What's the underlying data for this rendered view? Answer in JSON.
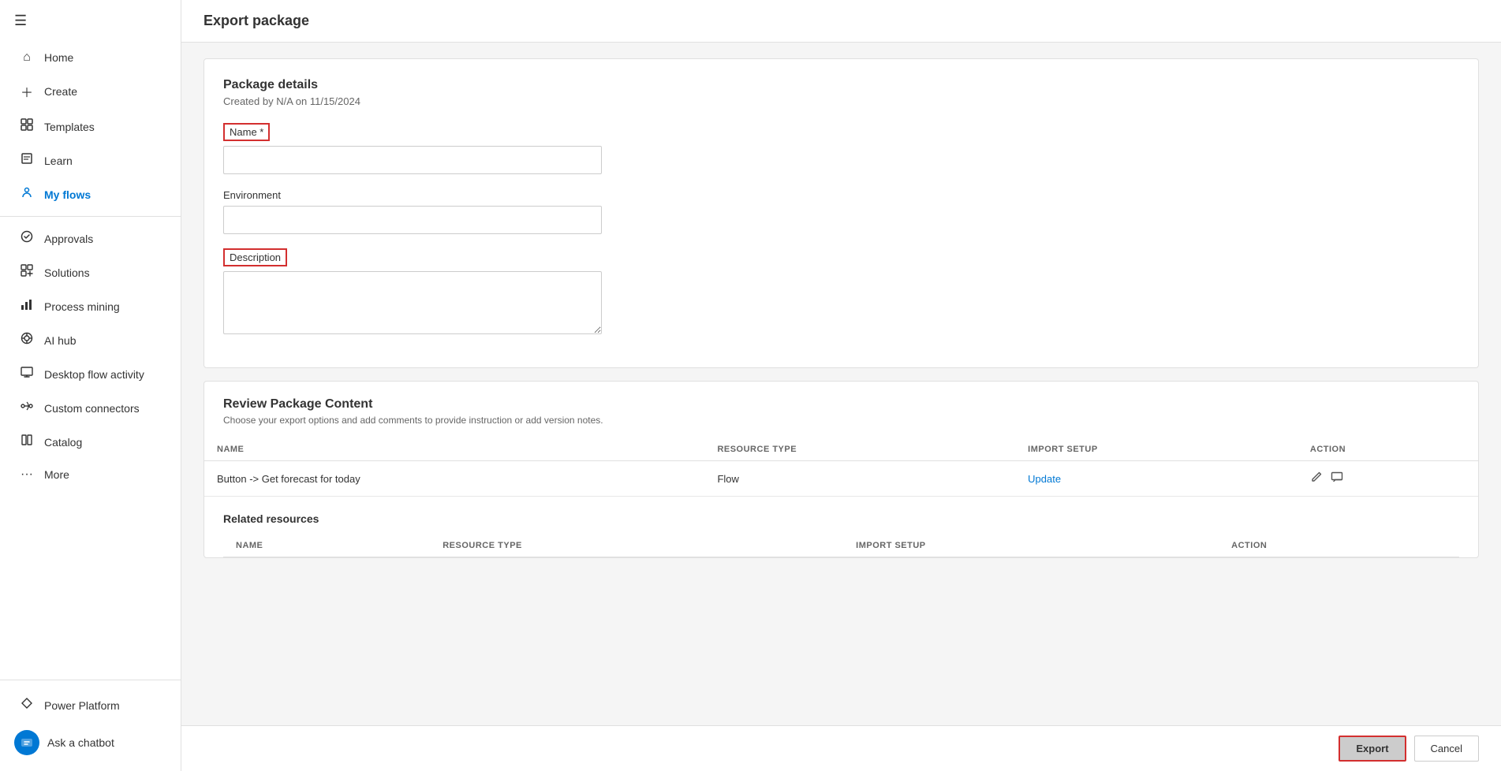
{
  "sidebar": {
    "hamburger_icon": "☰",
    "items": [
      {
        "id": "home",
        "label": "Home",
        "icon": "⌂",
        "active": false
      },
      {
        "id": "create",
        "label": "Create",
        "icon": "+",
        "active": false
      },
      {
        "id": "templates",
        "label": "Templates",
        "icon": "📄",
        "active": false
      },
      {
        "id": "learn",
        "label": "Learn",
        "icon": "📖",
        "active": false
      },
      {
        "id": "my-flows",
        "label": "My flows",
        "icon": "💧",
        "active": true
      },
      {
        "id": "approvals",
        "label": "Approvals",
        "icon": "✅",
        "active": false
      },
      {
        "id": "solutions",
        "label": "Solutions",
        "icon": "🧩",
        "active": false
      },
      {
        "id": "process-mining",
        "label": "Process mining",
        "icon": "📊",
        "active": false
      },
      {
        "id": "ai-hub",
        "label": "AI hub",
        "icon": "🤖",
        "active": false
      },
      {
        "id": "desktop-flow-activity",
        "label": "Desktop flow activity",
        "icon": "🖥",
        "active": false
      },
      {
        "id": "custom-connectors",
        "label": "Custom connectors",
        "icon": "🔗",
        "active": false
      },
      {
        "id": "catalog",
        "label": "Catalog",
        "icon": "📚",
        "active": false
      },
      {
        "id": "more",
        "label": "More",
        "icon": "···",
        "active": false
      }
    ],
    "bottom": {
      "power_platform_label": "Power Platform",
      "chatbot_label": "Ask a chatbot"
    }
  },
  "page": {
    "title": "Export package"
  },
  "package_details": {
    "section_title": "Package details",
    "created_text": "Created by N/A on 11/15/2024",
    "name_label": "Name *",
    "name_placeholder": "",
    "name_value": "",
    "environment_label": "Environment",
    "environment_placeholder": "",
    "environment_value": "",
    "description_label": "Description",
    "description_placeholder": "",
    "description_value": ""
  },
  "review_package": {
    "section_title": "Review Package Content",
    "subtitle": "Choose your export options and add comments to provide instruction or add version notes.",
    "table_headers": {
      "name": "NAME",
      "resource_type": "RESOURCE TYPE",
      "import_setup": "IMPORT SETUP",
      "action": "ACTION"
    },
    "rows": [
      {
        "name": "Button -> Get forecast for today",
        "resource_type": "Flow",
        "import_setup": "Update",
        "action_edit": "✏",
        "action_comment": "💬"
      }
    ]
  },
  "related_resources": {
    "title": "Related resources",
    "table_headers": {
      "name": "NAME",
      "resource_type": "RESOURCE TYPE",
      "import_setup": "IMPORT SETUP",
      "action": "ACTION"
    },
    "rows": []
  },
  "footer": {
    "export_label": "Export",
    "cancel_label": "Cancel"
  }
}
